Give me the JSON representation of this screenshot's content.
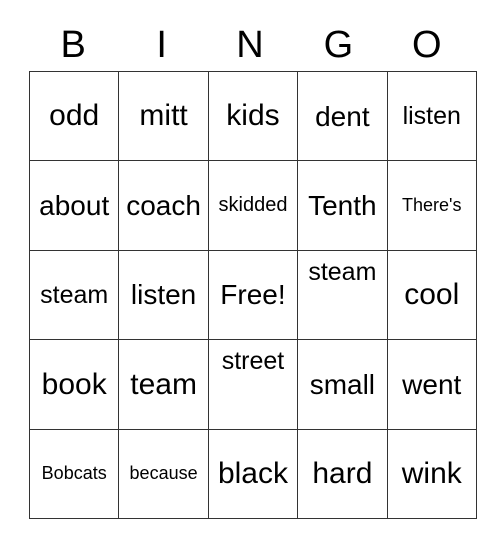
{
  "card": {
    "title": "BINGO",
    "header_letters": [
      "B",
      "I",
      "N",
      "G",
      "O"
    ],
    "columns": 5,
    "rows": 5,
    "free_space": "Free!",
    "border_color": "#333333",
    "background_color": "#ffffff",
    "text_color": "#000000",
    "grid": [
      [
        {
          "text": "odd",
          "size": "fs-xl",
          "align": "va-middle"
        },
        {
          "text": "mitt",
          "size": "fs-xl",
          "align": "va-middle"
        },
        {
          "text": "kids",
          "size": "fs-xl",
          "align": "va-middle"
        },
        {
          "text": "dent",
          "size": "fs-lg",
          "align": "va-middle"
        },
        {
          "text": "listen",
          "size": "fs-md",
          "align": "va-middle"
        }
      ],
      [
        {
          "text": "about",
          "size": "fs-lg",
          "align": "va-middle"
        },
        {
          "text": "coach",
          "size": "fs-lg",
          "align": "va-middle"
        },
        {
          "text": "skidded",
          "size": "fs-sm",
          "align": "va-middle"
        },
        {
          "text": "Tenth",
          "size": "fs-lg",
          "align": "va-middle"
        },
        {
          "text": "There's",
          "size": "fs-xs",
          "align": "va-middle"
        }
      ],
      [
        {
          "text": "steam",
          "size": "fs-md",
          "align": "va-middle"
        },
        {
          "text": "listen",
          "size": "fs-lg",
          "align": "va-middle"
        },
        {
          "text": "Free!",
          "size": "fs-lg",
          "align": "va-middle"
        },
        {
          "text": "steam",
          "size": "fs-md",
          "align": "va-top"
        },
        {
          "text": "cool",
          "size": "fs-xl",
          "align": "va-middle"
        }
      ],
      [
        {
          "text": "book",
          "size": "fs-xl",
          "align": "va-middle"
        },
        {
          "text": "team",
          "size": "fs-xl",
          "align": "va-middle"
        },
        {
          "text": "street",
          "size": "fs-md",
          "align": "va-top"
        },
        {
          "text": "small",
          "size": "fs-lg",
          "align": "va-middle"
        },
        {
          "text": "went",
          "size": "fs-lg",
          "align": "va-middle"
        }
      ],
      [
        {
          "text": "Bobcats",
          "size": "fs-xs",
          "align": "va-middle"
        },
        {
          "text": "because",
          "size": "fs-xs",
          "align": "va-middle"
        },
        {
          "text": "black",
          "size": "fs-xl",
          "align": "va-middle"
        },
        {
          "text": "hard",
          "size": "fs-xl",
          "align": "va-middle"
        },
        {
          "text": "wink",
          "size": "fs-xl",
          "align": "va-middle"
        }
      ]
    ]
  }
}
